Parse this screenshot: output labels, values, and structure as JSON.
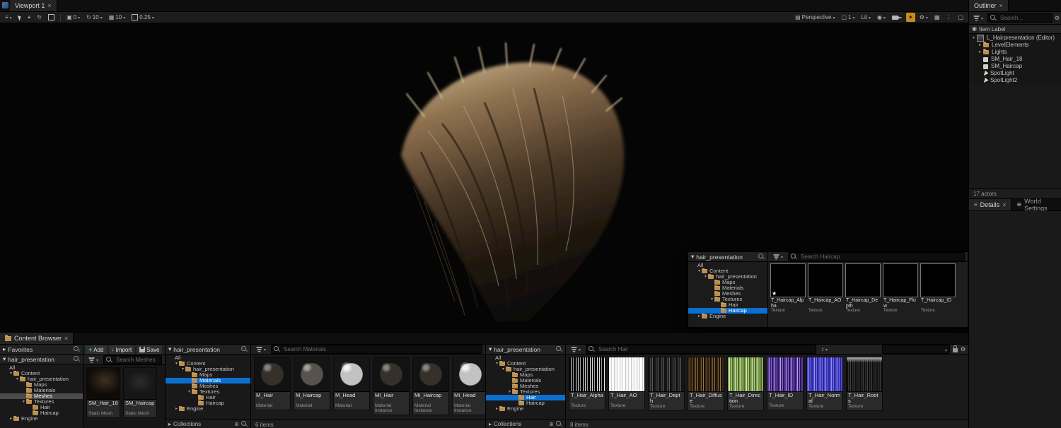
{
  "colors": {
    "accent": "#0a6fd0",
    "folder": "#bd8f4d",
    "highlight_orange": "#c98a1c"
  },
  "viewport": {
    "tab": "Viewport 1",
    "snaps": {
      "surface": "0",
      "rotation": "10",
      "grid": "10",
      "scale": "0.25"
    },
    "right": {
      "perspective": "Perspective",
      "screen": "1",
      "lit": "Lit"
    }
  },
  "outliner": {
    "tab": "Outliner",
    "search_placeholder": "Search...",
    "column_header": "Item Label",
    "items": [
      {
        "label": "L_Hairpresentation (Editor)",
        "icon": "level",
        "depth": 0,
        "expand": "open"
      },
      {
        "label": "LevelElements",
        "icon": "folder",
        "depth": 1,
        "expand": "closed"
      },
      {
        "label": "Lights",
        "icon": "folder",
        "depth": 1,
        "expand": "closed"
      },
      {
        "label": "SM_Hair_18",
        "icon": "mesh",
        "depth": 1
      },
      {
        "label": "SM_Haircap",
        "icon": "mesh",
        "depth": 1
      },
      {
        "label": "SpotLight",
        "icon": "light",
        "depth": 1
      },
      {
        "label": "SpotLight2",
        "icon": "light",
        "depth": 1
      }
    ],
    "footer": "17 actors"
  },
  "details": {
    "tab": "Details",
    "world_settings": "World Settings"
  },
  "cb": {
    "tab": "Content Browser",
    "add": "Add",
    "import": "Import",
    "save": "Save",
    "favorites": "Favorites",
    "path": "hair_presentation",
    "collections": "Collections",
    "search_meshes": "Search Meshes",
    "search_materials": "Search Materials",
    "search_hair": "Search Hair",
    "items_6": "6 items",
    "items_8": "8 items",
    "sidebar_tree": [
      {
        "label": "All",
        "depth": 0,
        "icon": "none"
      },
      {
        "label": "Content",
        "depth": 1,
        "icon": "folder",
        "expand": "open"
      },
      {
        "label": "hair_presentation",
        "depth": 2,
        "icon": "folder",
        "expand": "open"
      },
      {
        "label": "Maps",
        "depth": 3,
        "icon": "folder"
      },
      {
        "label": "Materials",
        "depth": 3,
        "icon": "folder"
      },
      {
        "label": "Meshes",
        "depth": 3,
        "icon": "folder",
        "selected": "gray"
      },
      {
        "label": "Textures",
        "depth": 3,
        "icon": "folder",
        "expand": "open"
      },
      {
        "label": "Hair",
        "depth": 4,
        "icon": "folder"
      },
      {
        "label": "Haircap",
        "depth": 4,
        "icon": "folder"
      },
      {
        "label": "Engine",
        "depth": 1,
        "icon": "folder",
        "expand": "closed"
      }
    ],
    "materials_tree": [
      {
        "label": "All",
        "depth": 0,
        "icon": "none"
      },
      {
        "label": "Content",
        "depth": 1,
        "icon": "folder",
        "expand": "open"
      },
      {
        "label": "hair_presentation",
        "depth": 2,
        "icon": "folder",
        "expand": "open"
      },
      {
        "label": "Maps",
        "depth": 3,
        "icon": "folder"
      },
      {
        "label": "Materials",
        "depth": 3,
        "icon": "folder",
        "selected": "blue"
      },
      {
        "label": "Meshes",
        "depth": 3,
        "icon": "folder"
      },
      {
        "label": "Textures",
        "depth": 3,
        "icon": "folder",
        "expand": "open"
      },
      {
        "label": "Hair",
        "depth": 4,
        "icon": "folder"
      },
      {
        "label": "Haircap",
        "depth": 4,
        "icon": "folder"
      },
      {
        "label": "Engine",
        "depth": 1,
        "icon": "folder",
        "expand": "closed"
      }
    ],
    "hair_tree": [
      {
        "label": "All",
        "depth": 0,
        "icon": "none"
      },
      {
        "label": "Content",
        "depth": 1,
        "icon": "folder",
        "expand": "open"
      },
      {
        "label": "hair_presentation",
        "depth": 2,
        "icon": "folder",
        "expand": "open"
      },
      {
        "label": "Maps",
        "depth": 3,
        "icon": "folder"
      },
      {
        "label": "Materials",
        "depth": 3,
        "icon": "folder"
      },
      {
        "label": "Meshes",
        "depth": 3,
        "icon": "folder"
      },
      {
        "label": "Textures",
        "depth": 3,
        "icon": "folder",
        "expand": "open"
      },
      {
        "label": "Hair",
        "depth": 4,
        "icon": "folder",
        "selected": "blue"
      },
      {
        "label": "Haircap",
        "depth": 4,
        "icon": "folder"
      },
      {
        "label": "Engine",
        "depth": 1,
        "icon": "folder",
        "expand": "closed"
      }
    ],
    "meshes_assets": [
      {
        "name": "SM_Hair_18",
        "type": "Static Mesh",
        "thumb": "smhair"
      },
      {
        "name": "SM_Haircap",
        "type": "Static Mesh",
        "thumb": "smcap"
      }
    ],
    "materials_assets": [
      {
        "name": "M_Hair",
        "type": "Material",
        "thumb": "sph-dark"
      },
      {
        "name": "M_Haircap",
        "type": "Material",
        "thumb": "sph-mid"
      },
      {
        "name": "M_Head",
        "type": "Material",
        "thumb": "sph-light"
      },
      {
        "name": "MI_Hair",
        "type": "Material Instance",
        "thumb": "sph-dark"
      },
      {
        "name": "MI_Haircap",
        "type": "Material Instance",
        "thumb": "sph-dark"
      },
      {
        "name": "MI_Head",
        "type": "Material Instance",
        "thumb": "sph-light"
      }
    ],
    "hair_assets": [
      {
        "name": "T_Hair_Alpha",
        "type": "Texture",
        "thumb": "halpha"
      },
      {
        "name": "T_Hair_AO",
        "type": "Texture",
        "thumb": "hao"
      },
      {
        "name": "T_Hair_Depth",
        "type": "Texture",
        "thumb": "hdepth"
      },
      {
        "name": "T_Hair_Diffuse",
        "type": "Texture",
        "thumb": "hdiff"
      },
      {
        "name": "T_Hair_Direction",
        "type": "Texture",
        "thumb": "hdir"
      },
      {
        "name": "T_Hair_ID",
        "type": "Texture",
        "thumb": "hid"
      },
      {
        "name": "T_Hair_Normal",
        "type": "Texture",
        "thumb": "hnorm"
      },
      {
        "name": "T_Hair_Roots",
        "type": "Texture",
        "thumb": "hroots"
      }
    ]
  },
  "floating": {
    "path": "hair_presentation",
    "search": "Search Haircap",
    "tree": [
      {
        "label": "All",
        "depth": 0,
        "icon": "none"
      },
      {
        "label": "Content",
        "depth": 1,
        "icon": "folder",
        "expand": "open"
      },
      {
        "label": "hair_presentation",
        "depth": 2,
        "icon": "folder",
        "expand": "open"
      },
      {
        "label": "Maps",
        "depth": 3,
        "icon": "folder"
      },
      {
        "label": "Materials",
        "depth": 3,
        "icon": "folder"
      },
      {
        "label": "Meshes",
        "depth": 3,
        "icon": "folder"
      },
      {
        "label": "Textures",
        "depth": 3,
        "icon": "folder",
        "expand": "open"
      },
      {
        "label": "Hair",
        "depth": 4,
        "icon": "folder"
      },
      {
        "label": "Haircap",
        "depth": 4,
        "icon": "folder",
        "selected": "blue"
      },
      {
        "label": "Engine",
        "depth": 1,
        "icon": "folder",
        "expand": "closed"
      }
    ],
    "assets": [
      {
        "name": "T_Haircap_Alpha",
        "type": "Texture",
        "thumb": "calpha",
        "fav": true
      },
      {
        "name": "T_Haircap_AO",
        "type": "Texture",
        "thumb": "cao"
      },
      {
        "name": "T_Haircap_Depth",
        "type": "Texture",
        "thumb": "cdepth"
      },
      {
        "name": "T_Haircap_Flow",
        "type": "Texture",
        "thumb": "cflow"
      },
      {
        "name": "T_Haircap_ID",
        "type": "Texture",
        "thumb": "cid"
      }
    ]
  }
}
